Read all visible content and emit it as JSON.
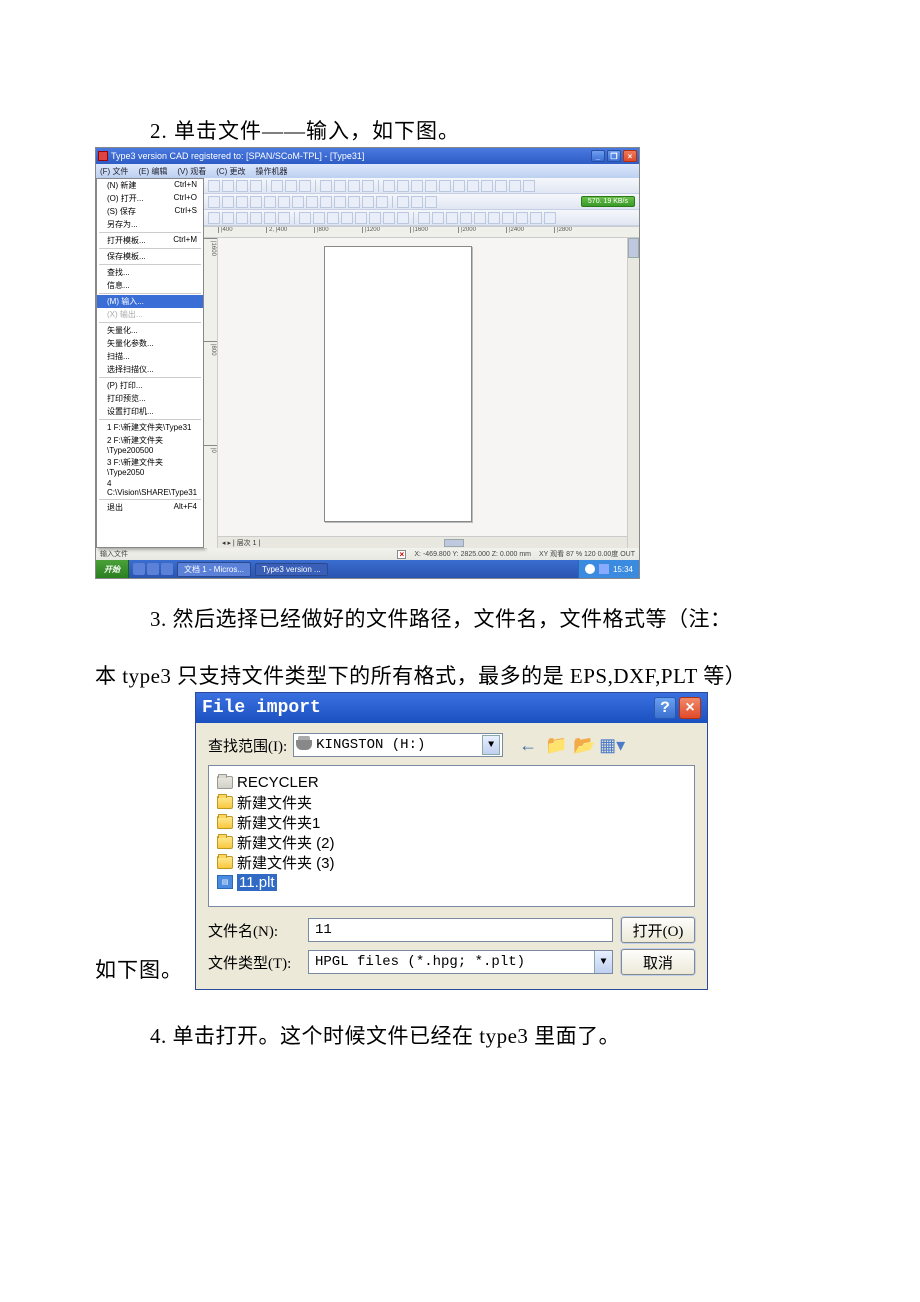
{
  "step2_text": "2. 单击文件——输入，如下图。",
  "app": {
    "title": "Type3 version CAD registered to: [SPAN/SCoM-TPL] - [Type31]",
    "menubar": [
      "(F) 文件",
      "(E) 编辑",
      "(V) 观看",
      "(C) 更改",
      "操作机器"
    ],
    "file_menu": {
      "new": "(N) 新建",
      "new_sc": "Ctrl+N",
      "open": "(O) 打开...",
      "open_sc": "Ctrl+O",
      "save": "(S) 保存",
      "save_sc": "Ctrl+S",
      "saveAs": "另存为...",
      "openTpl": "打开模板...",
      "openTpl_sc": "Ctrl+M",
      "saveTpl": "保存模板...",
      "find": "查找...",
      "info": "信息...",
      "import": "(M) 输入...",
      "export": "(X) 输出...",
      "vector": "矢量化...",
      "vectorParam": "矢量化参数...",
      "scan": "扫描...",
      "selScanner": "选择扫描仪...",
      "print": "(P) 打印...",
      "printPrev": "打印预览...",
      "printSetup": "设置打印机...",
      "recent1": "1 F:\\新建文件夹\\Type31",
      "recent2": "2 F:\\新建文件夹\\Type200500",
      "recent3": "3 F:\\新建文件夹\\Type2050",
      "recent4": "4 C:\\Vision\\SHARE\\Type31",
      "exit": "退出",
      "exit_sc": "Alt+F4"
    },
    "pill": "570. 19 KB/s",
    "ruler_h": [
      "|400",
      "2, |400",
      "|800",
      "|1200",
      "|1600",
      "|2000",
      "|2400",
      "|2800"
    ],
    "ruler_v": [
      "|1600",
      "|800",
      "|0"
    ],
    "tabs_label": "层次 1",
    "status_left": "输入文件",
    "status_coords": "X: -469.800   Y: 2825.000   Z: 0.000 mm",
    "status_view": "XY 观看  87 % 120 0.00度 OUT",
    "taskbar": {
      "start": "开始",
      "task1": "文档 1 - Micros...",
      "task2": "Type3 version ...",
      "clock": "15:34"
    }
  },
  "step3_line1": "3. 然后选择已经做好的文件路径，文件名，文件格式等（注：",
  "step3_line2": "本 type3 只支持文件类型下的所有格式，最多的是 EPS,DXF,PLT 等）",
  "dialog_prefix": "如下图。",
  "dialog": {
    "title": "File import",
    "lookin_label": "查找范围(I):",
    "lookin_value": "KINGSTON (H:)",
    "items": {
      "recycler": "RECYCLER",
      "f1": "新建文件夹",
      "f2": "新建文件夹1",
      "f3": "新建文件夹 (2)",
      "f4": "新建文件夹 (3)",
      "file": "11.plt"
    },
    "fname_label": "文件名(N):",
    "fname_value": "11",
    "ftype_label": "文件类型(T):",
    "ftype_value": "HPGL files (*.hpg; *.plt)",
    "open_btn": "打开(O)",
    "cancel_btn": "取消"
  },
  "step4_text": "4. 单击打开。这个时候文件已经在 type3 里面了。"
}
